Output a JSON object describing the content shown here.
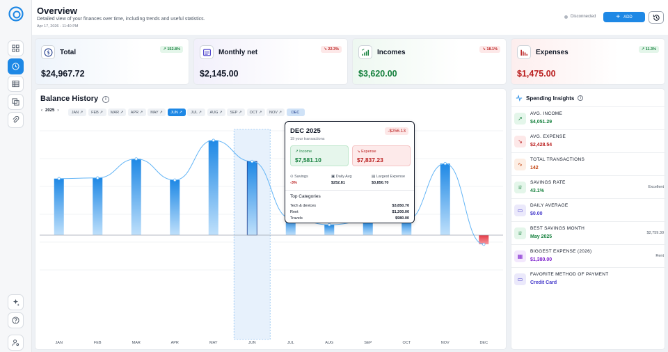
{
  "header": {
    "title": "Overview",
    "subtitle": "Detailed view of your finances over time, including trends and useful statistics.",
    "date": "Apr 17, 2026 - 11:40 PM",
    "status": "Disconnected",
    "add_label": "ADD"
  },
  "stats": [
    {
      "label": "Total",
      "value": "$24,967.72",
      "badge": "152.8%",
      "trend": "up",
      "value_color": "#111827"
    },
    {
      "label": "Monthly net",
      "value": "$2,145.00",
      "badge": "22.3%",
      "trend": "down",
      "value_color": "#111827"
    },
    {
      "label": "Incomes",
      "value": "$3,620.00",
      "badge": "18.1%",
      "trend": "down",
      "value_color": "#15803d"
    },
    {
      "label": "Expenses",
      "value": "$1,475.00",
      "badge": "11.3%",
      "trend": "up",
      "value_color": "#b91c1c"
    }
  ],
  "balance": {
    "title": "Balance History",
    "year": "2025",
    "months": [
      "JAN",
      "FEB",
      "MAR",
      "APR",
      "MAY",
      "JUN",
      "JUL",
      "AUG",
      "SEP",
      "OCT",
      "NOV",
      "DEC"
    ],
    "active_month": "JUN",
    "selected_month": "DEC"
  },
  "chart_data": {
    "type": "bar",
    "categories": [
      "JAN",
      "FEB",
      "MAR",
      "APR",
      "MAY",
      "JUN",
      "JUL",
      "AUG",
      "SEP",
      "OCT",
      "NOV",
      "DEC"
    ],
    "values": [
      1580,
      1600,
      2130,
      1540,
      2650,
      2060,
      470,
      290,
      390,
      420,
      2000,
      -256.13
    ],
    "ylim": [
      -500,
      3000
    ],
    "grid": true,
    "highlight": "JUN",
    "colors": {
      "positive": "#1e88e5",
      "negative": "#e53945",
      "line": "#64b5f6"
    }
  },
  "tooltip": {
    "month": "DEC 2025",
    "transactions": "19 your transactions",
    "diff": "-$256.13",
    "income_label": "Income",
    "income_value": "$7,581.10",
    "expense_label": "Expense",
    "expense_value": "$7,837.23",
    "savings_label": "Savings",
    "savings_value": "-3%",
    "daily_label": "Daily Avg",
    "daily_value": "$252.81",
    "largest_label": "Largest Expense",
    "largest_value": "$3,850.70",
    "categories_title": "Top Categories",
    "categories": [
      {
        "name": "Tech & devices",
        "amount": "$3,850.70"
      },
      {
        "name": "Rent",
        "amount": "$1,200.00"
      },
      {
        "name": "Travels",
        "amount": "$980.00"
      }
    ]
  },
  "insights": {
    "title": "Spending Insights",
    "items": [
      {
        "label": "AVG. INCOME",
        "value": "$4,051.29",
        "right": "",
        "icon": "arrow-up-right-icon",
        "color": "#15803d",
        "bg": "#e4f6ea"
      },
      {
        "label": "AVG. EXPENSE",
        "value": "$2,428.54",
        "right": "",
        "icon": "arrow-down-right-icon",
        "color": "#b91c1c",
        "bg": "#fde8e8"
      },
      {
        "label": "TOTAL TRANSACTIONS",
        "value": "142",
        "right": "",
        "icon": "activity-icon",
        "color": "#c2410c",
        "bg": "#fdeee4"
      },
      {
        "label": "SAVINGS RATE",
        "value": "43.1%",
        "right": "Excellent",
        "icon": "trophy-icon",
        "color": "#15803d",
        "bg": "#e4f6ea"
      },
      {
        "label": "DAILY AVERAGE",
        "value": "$0.00",
        "right": "",
        "icon": "card-icon",
        "color": "#4338ca",
        "bg": "#ebe9fb"
      },
      {
        "label": "BEST SAVINGS MONTH",
        "value": "May 2025",
        "right": "$2,759.30",
        "icon": "trophy-icon",
        "color": "#15803d",
        "bg": "#e4f6ea"
      },
      {
        "label": "BIGGEST EXPENSE (2026)",
        "value": "$1,380.00",
        "right": "Rent",
        "icon": "calendar-icon",
        "color": "#7e22ce",
        "bg": "#f3e8fd"
      },
      {
        "label": "FAVORITE METHOD OF PAYMENT",
        "value": "Credit Card",
        "right": "",
        "icon": "card-icon",
        "color": "#4338ca",
        "bg": "#ebe9fb"
      }
    ]
  }
}
